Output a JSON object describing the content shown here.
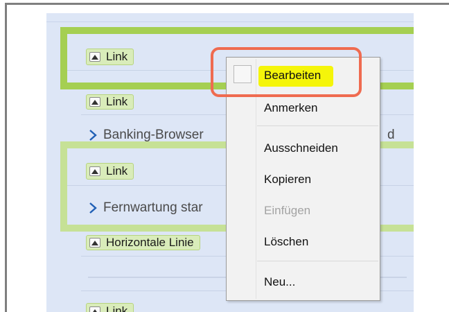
{
  "editor": {
    "blocks": [
      {
        "tag": "Link"
      },
      {
        "tag": "Link"
      },
      {
        "link_text": "Banking-Browser",
        "link_suffix": "d"
      },
      {
        "tag": "Link"
      },
      {
        "link_text": "Fernwartung star"
      },
      {
        "tag": "Horizontale Linie"
      },
      {
        "tag": "Link"
      }
    ]
  },
  "context_menu": {
    "items": [
      {
        "label": "Bearbeiten",
        "state": "highlighted"
      },
      {
        "label": "Anmerken",
        "state": "enabled"
      },
      {
        "label": "Ausschneiden",
        "state": "enabled"
      },
      {
        "label": "Kopieren",
        "state": "enabled"
      },
      {
        "label": "Einfügen",
        "state": "disabled"
      },
      {
        "label": "Löschen",
        "state": "enabled"
      },
      {
        "label": "Neu...",
        "state": "enabled"
      }
    ]
  },
  "colors": {
    "editor_bg": "#dde6f6",
    "block_green_strong": "#a5cf52",
    "block_green_soft": "#c6e196",
    "tag_bg": "#d9ecba",
    "link_chevron": "#1f5fb5",
    "menu_bg": "#f2f2f2",
    "highlight_yellow": "#f5f50a",
    "annotation_ring": "#ef6b50"
  },
  "icons": {
    "collapse": "triangle-up-icon",
    "link": "chevron-right-icon"
  }
}
